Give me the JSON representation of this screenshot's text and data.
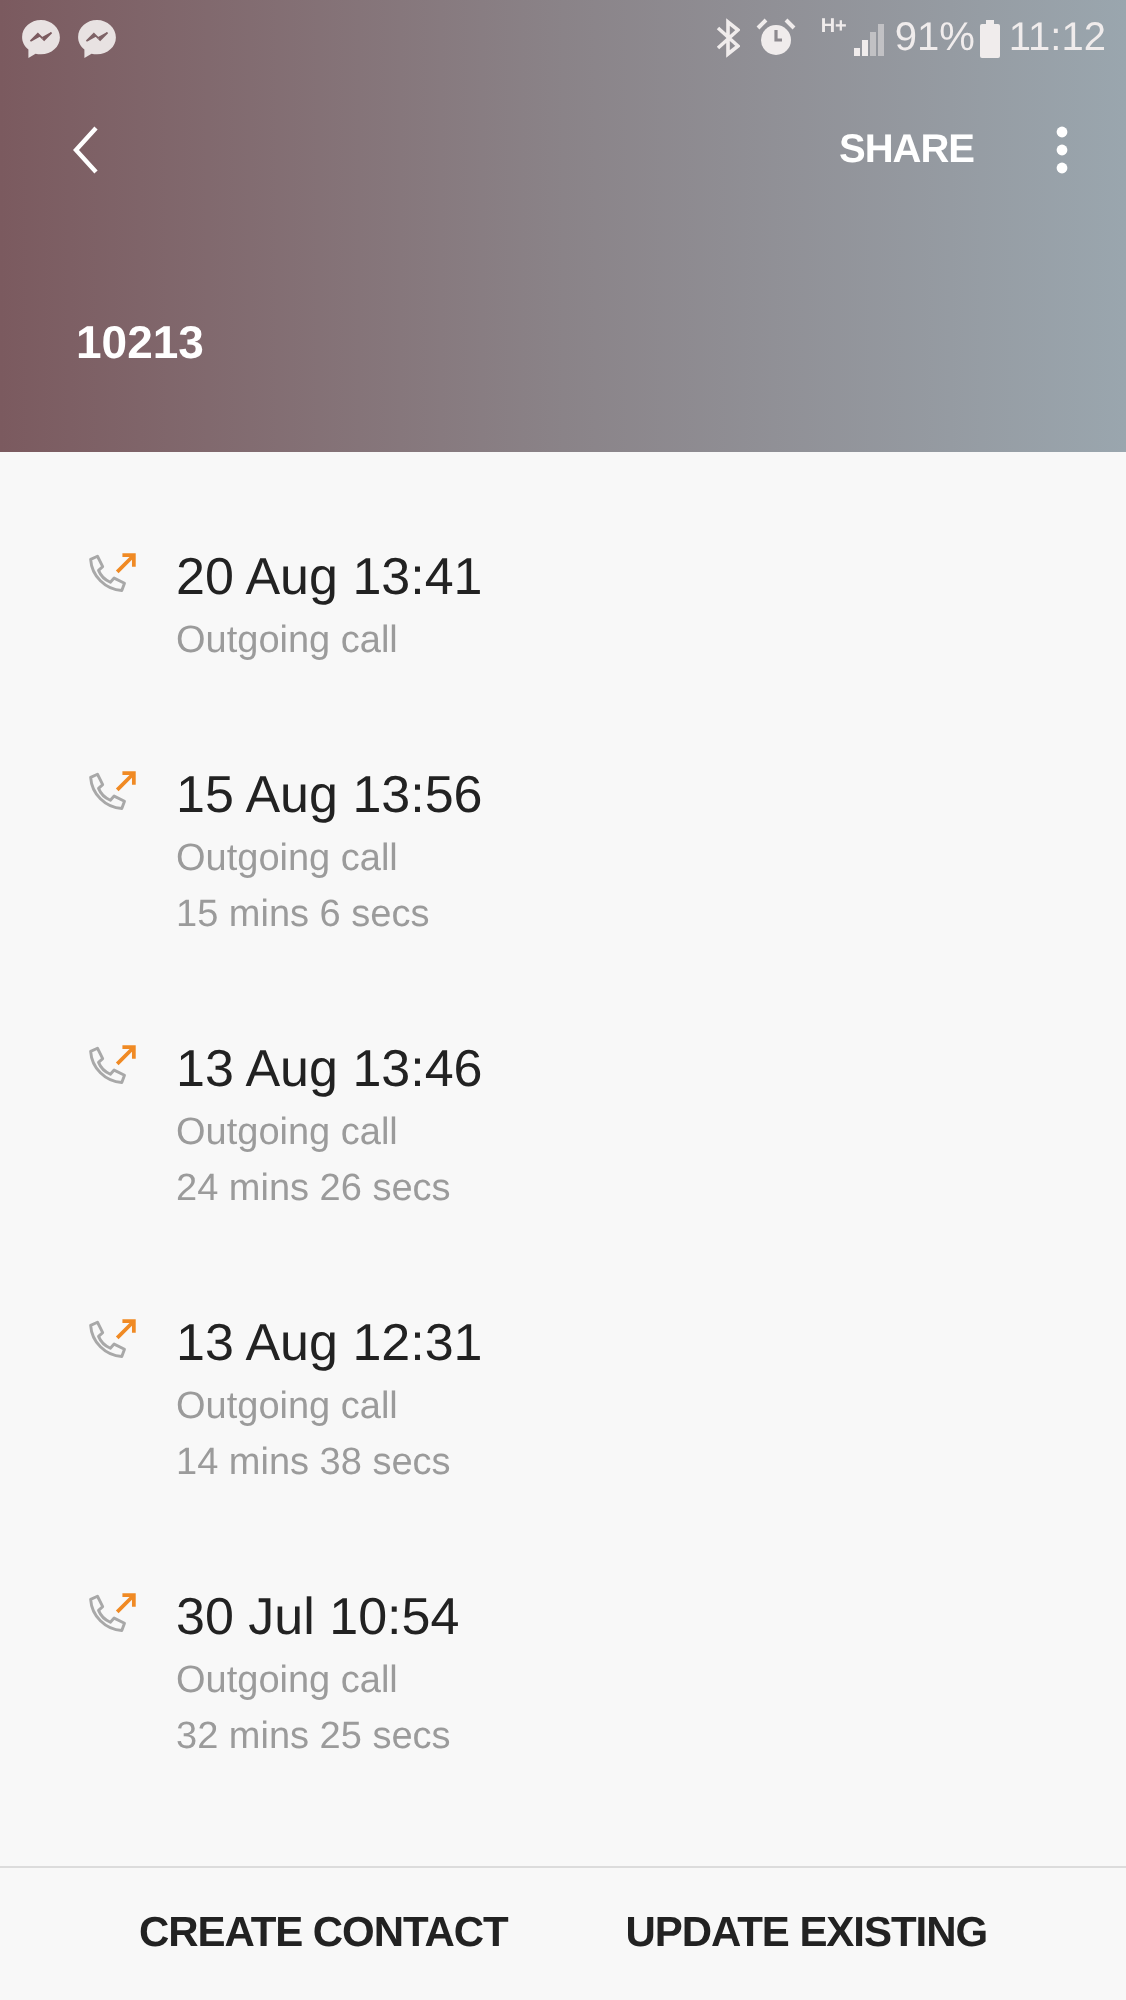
{
  "status_bar": {
    "network": "H+",
    "battery": "91%",
    "time": "11:12"
  },
  "toolbar": {
    "action": "SHARE"
  },
  "contact": {
    "number": "10213"
  },
  "calls": [
    {
      "kind": "outgoing",
      "date": "20 Aug 13:41",
      "type": "Outgoing call"
    },
    {
      "kind": "outgoing",
      "date": "15 Aug 13:56",
      "type": "Outgoing call",
      "duration": "15 mins 6 secs"
    },
    {
      "kind": "outgoing",
      "date": "13 Aug 13:46",
      "type": "Outgoing call",
      "duration": "24 mins 26 secs"
    },
    {
      "kind": "outgoing",
      "date": "13 Aug 12:31",
      "type": "Outgoing call",
      "duration": "14 mins 38 secs"
    },
    {
      "kind": "outgoing",
      "date": "30 Jul 10:54",
      "type": "Outgoing call",
      "duration": "32 mins 25 secs"
    }
  ],
  "buttons": [
    "CREATE CONTACT",
    "UPDATE EXISTING"
  ]
}
